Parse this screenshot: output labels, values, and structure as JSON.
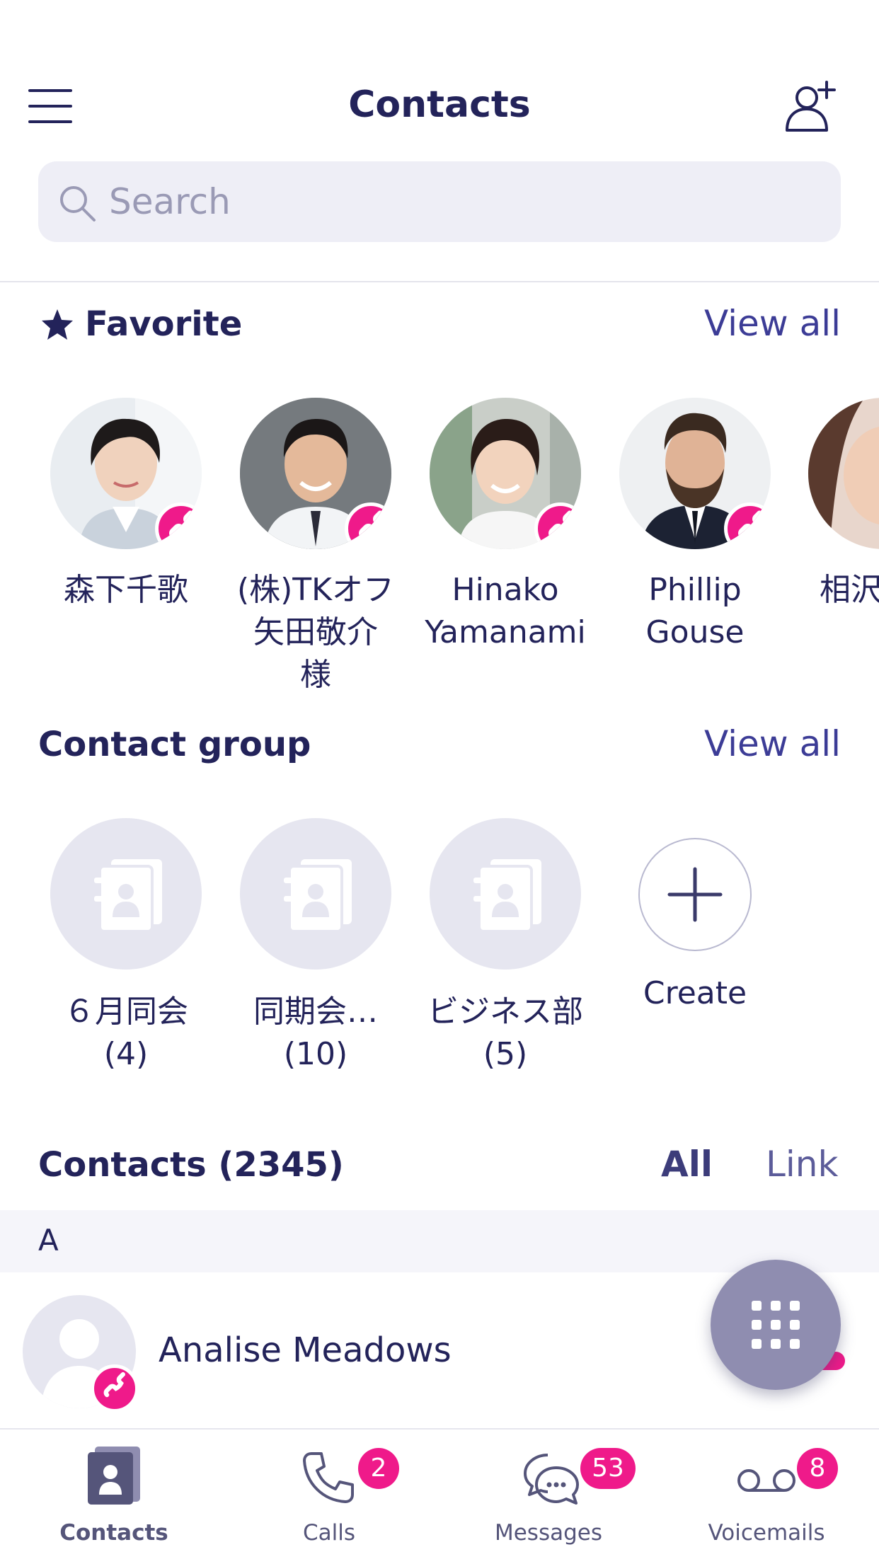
{
  "header": {
    "title": "Contacts"
  },
  "search": {
    "placeholder": "Search"
  },
  "favorites": {
    "title": "Favorite",
    "view_all": "View all",
    "items": [
      {
        "name": "森下千歌"
      },
      {
        "name": "(株)TKオフ 矢田敬介 様"
      },
      {
        "name": "Hinako Yamanami"
      },
      {
        "name": "Phillip Gouse"
      },
      {
        "name": "相沢"
      }
    ]
  },
  "groups": {
    "title": "Contact group",
    "view_all": "View all",
    "items": [
      {
        "name": "６月同会",
        "count": "(4)"
      },
      {
        "name": "同期会…",
        "count": "(10)"
      },
      {
        "name": "ビジネス部",
        "count": "(5)"
      }
    ],
    "create_label": "Create"
  },
  "contacts": {
    "title": "Contacts (2345)",
    "filter_all": "All",
    "filter_link": "Link",
    "letter": "A",
    "rows": [
      {
        "name": "Analise Meadows"
      }
    ]
  },
  "tabs": [
    {
      "label": "Contacts",
      "badge": ""
    },
    {
      "label": "Calls",
      "badge": "2"
    },
    {
      "label": "Messages",
      "badge": "53"
    },
    {
      "label": "Voicemails",
      "badge": "8"
    }
  ],
  "colors": {
    "accent": "#ef1a8a",
    "primary": "#23235a",
    "fab": "#8f8db0"
  }
}
